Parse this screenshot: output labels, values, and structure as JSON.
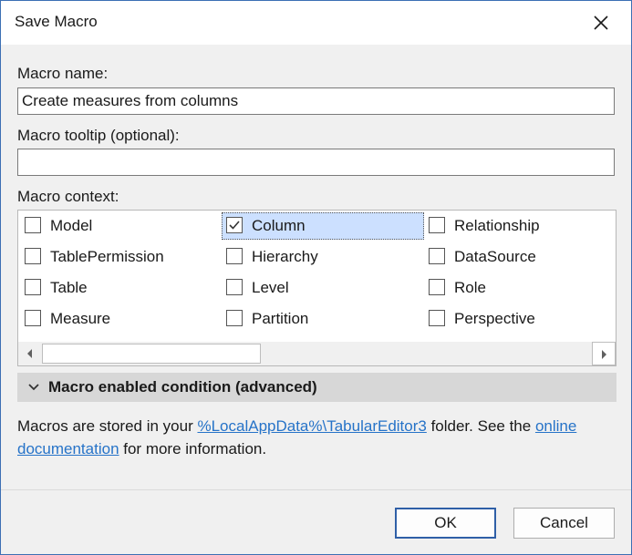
{
  "window": {
    "title": "Save Macro"
  },
  "form": {
    "macro_name_label": "Macro name:",
    "macro_name_value": "Create measures from columns",
    "tooltip_label": "Macro tooltip (optional):",
    "tooltip_value": "",
    "context_label": "Macro context:"
  },
  "context_items": [
    {
      "label": "Model",
      "checked": false,
      "selected": false
    },
    {
      "label": "Column",
      "checked": true,
      "selected": true
    },
    {
      "label": "Relationship",
      "checked": false,
      "selected": false
    },
    {
      "label": "TablePermission",
      "checked": false,
      "selected": false
    },
    {
      "label": "Hierarchy",
      "checked": false,
      "selected": false
    },
    {
      "label": "DataSource",
      "checked": false,
      "selected": false
    },
    {
      "label": "Table",
      "checked": false,
      "selected": false
    },
    {
      "label": "Level",
      "checked": false,
      "selected": false
    },
    {
      "label": "Role",
      "checked": false,
      "selected": false
    },
    {
      "label": "Measure",
      "checked": false,
      "selected": false
    },
    {
      "label": "Partition",
      "checked": false,
      "selected": false
    },
    {
      "label": "Perspective",
      "checked": false,
      "selected": false
    }
  ],
  "expander": {
    "label": "Macro enabled condition (advanced)",
    "expanded": false
  },
  "info": {
    "text_before": "Macros are stored in your ",
    "link_path": "%LocalAppData%\\TabularEditor3",
    "text_middle": " folder. See the ",
    "link_docs": "online documentation",
    "text_after": " for more information."
  },
  "buttons": {
    "ok": "OK",
    "cancel": "Cancel"
  },
  "icons": {
    "close": "close-icon",
    "check": "checkmark-icon",
    "expander": "chevron-down-icon",
    "scroll_left": "scroll-left-arrow-icon",
    "scroll_right": "scroll-right-arrow-icon"
  },
  "colors": {
    "accent": "#3c6fb4",
    "link": "#2673c8",
    "selection": "#cce0ff",
    "primary_button_border": "#2f5fa7"
  }
}
